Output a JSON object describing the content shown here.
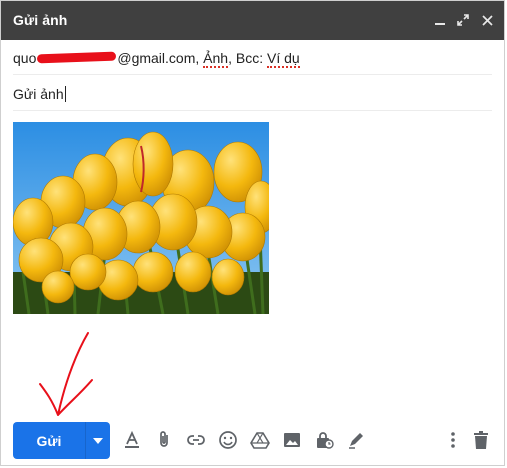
{
  "window": {
    "title": "Gửi ảnh"
  },
  "recipients": {
    "to_prefix": "quo",
    "to_suffix": "@gmail.com, ",
    "token_anh": "Ảnh",
    "bcc_label": ", Bcc: ",
    "token_vidu": "Ví dụ"
  },
  "subject": {
    "value": "Gửi ảnh"
  },
  "toolbar": {
    "send_label": "Gửi",
    "icons": [
      "minimize-icon",
      "expand-icon",
      "close-icon",
      "send-options-icon",
      "format-text-icon",
      "attach-icon",
      "link-icon",
      "emoji-icon",
      "drive-icon",
      "photo-icon",
      "confidential-icon",
      "signature-icon",
      "more-options-icon",
      "discard-icon"
    ]
  },
  "colors": {
    "titlebar": "#404040",
    "send": "#1a73e8",
    "icon": "#5f6368",
    "annotation": "#e8101a"
  }
}
